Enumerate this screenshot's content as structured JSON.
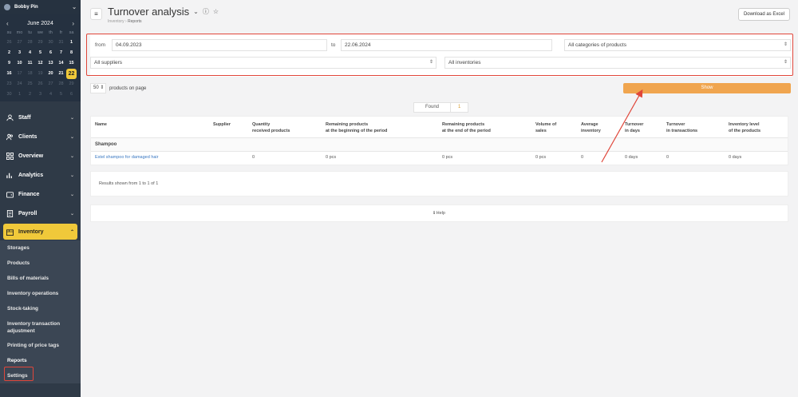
{
  "user": {
    "name": "Bobby Pin"
  },
  "calendar": {
    "month_label": "June 2024",
    "weekdays": [
      "su",
      "mo",
      "tu",
      "we",
      "th",
      "fr",
      "sa"
    ],
    "days": [
      {
        "d": "26",
        "m": true
      },
      {
        "d": "27",
        "m": true
      },
      {
        "d": "28",
        "m": true
      },
      {
        "d": "29",
        "m": true
      },
      {
        "d": "30",
        "m": true
      },
      {
        "d": "31",
        "m": true
      },
      {
        "d": "1",
        "m": false
      },
      {
        "d": "2",
        "m": false
      },
      {
        "d": "3",
        "m": false
      },
      {
        "d": "4",
        "m": false
      },
      {
        "d": "5",
        "m": false
      },
      {
        "d": "6",
        "m": false
      },
      {
        "d": "7",
        "m": false
      },
      {
        "d": "8",
        "m": false
      },
      {
        "d": "9",
        "m": false
      },
      {
        "d": "10",
        "m": false
      },
      {
        "d": "11",
        "m": false
      },
      {
        "d": "12",
        "m": false
      },
      {
        "d": "13",
        "m": false
      },
      {
        "d": "14",
        "m": false
      },
      {
        "d": "15",
        "m": false
      },
      {
        "d": "16",
        "m": false
      },
      {
        "d": "17",
        "m": true
      },
      {
        "d": "18",
        "m": true
      },
      {
        "d": "19",
        "m": true
      },
      {
        "d": "20",
        "m": false
      },
      {
        "d": "21",
        "m": false
      },
      {
        "d": "22",
        "m": false,
        "today": true
      },
      {
        "d": "23",
        "m": true
      },
      {
        "d": "24",
        "m": true
      },
      {
        "d": "25",
        "m": true
      },
      {
        "d": "26",
        "m": true
      },
      {
        "d": "27",
        "m": true
      },
      {
        "d": "28",
        "m": true
      },
      {
        "d": "29",
        "m": true
      },
      {
        "d": "30",
        "m": true
      },
      {
        "d": "1",
        "m": true
      },
      {
        "d": "2",
        "m": true
      },
      {
        "d": "3",
        "m": true
      },
      {
        "d": "4",
        "m": true
      },
      {
        "d": "5",
        "m": true
      },
      {
        "d": "6",
        "m": true
      }
    ]
  },
  "nav": {
    "staff": "Staff",
    "clients": "Clients",
    "overview": "Overview",
    "analytics": "Analytics",
    "finance": "Finance",
    "payroll": "Payroll",
    "inventory": "Inventory",
    "sub": {
      "storages": "Storages",
      "products": "Products",
      "bills": "Bills of materials",
      "operations": "Inventory operations",
      "stocktaking": "Stock-taking",
      "adjust1": "Inventory transaction",
      "adjust2": "adjustment",
      "pricetags": "Printing of price tags",
      "reports": "Reports",
      "settings": "Settings"
    }
  },
  "header": {
    "title": "Turnover analysis",
    "crumb_parent": "Inventory",
    "crumb_current": "Reports",
    "excel_label": "Download as Excel"
  },
  "filters": {
    "from_label": "from",
    "from_value": "04.09.2023",
    "to_label": "to",
    "to_value": "22.06.2024",
    "categories": "All categories of products",
    "suppliers": "All suppliers",
    "inventories": "All inventories"
  },
  "paging": {
    "per_page": "50",
    "per_page_label": "products on page"
  },
  "show_label": "Show",
  "found": {
    "label": "Found",
    "count": "1"
  },
  "table": {
    "headers": [
      [
        "Name",
        ""
      ],
      [
        "Supplier",
        ""
      ],
      [
        "Quantity",
        "received products"
      ],
      [
        "Remaining products",
        "at the beginning of the period"
      ],
      [
        "Remaining products",
        "at the end of the period"
      ],
      [
        "Volume of",
        "sales"
      ],
      [
        "Average",
        "inventory"
      ],
      [
        "Turnover",
        "in days"
      ],
      [
        "Turnover",
        "in transactions"
      ],
      [
        "Inventory level",
        "of the products"
      ]
    ],
    "group": "Shampoo",
    "row": {
      "name": "Estel shampoo for damaged hair",
      "supplier": "",
      "quantity": "0",
      "rem_begin": "0 pcs",
      "rem_end": "0 pcs",
      "volume": "0 pcs",
      "average": "0",
      "turn_days": "0 days",
      "turn_trans": "0",
      "inv_level": "0 days"
    }
  },
  "results_text": "Results shown from 1 to 1 of 1",
  "help_label": "Help",
  "colors": {
    "accent": "#f0c93a",
    "show": "#f0a54f",
    "highlight": "#e0463a",
    "sidebar": "#2f3a47"
  }
}
